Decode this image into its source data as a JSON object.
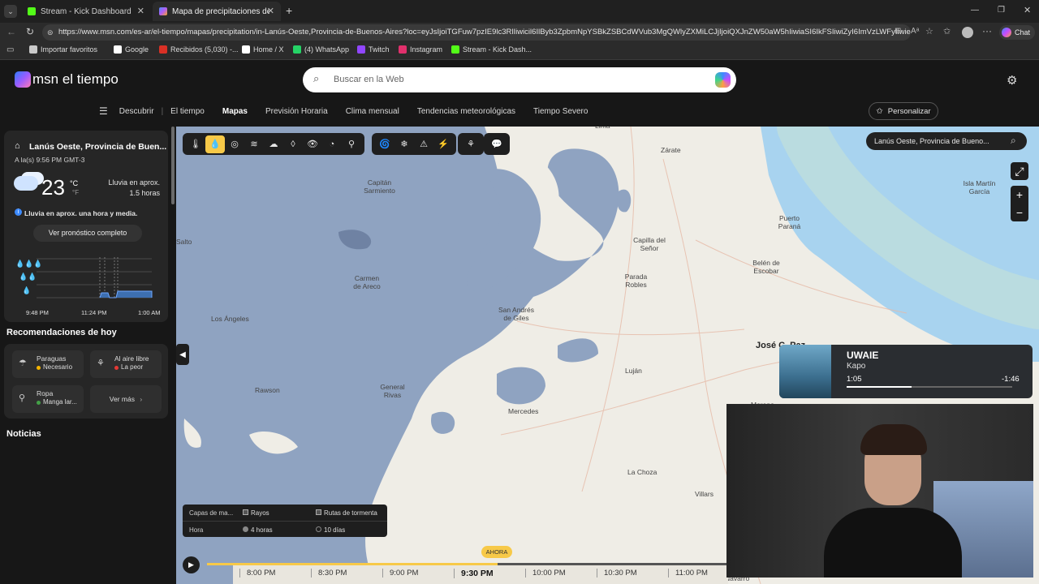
{
  "browser": {
    "tabs": [
      {
        "title": "Stream - Kick Dashboard",
        "active": false
      },
      {
        "title": "Mapa de precipitaciones de Lanús",
        "active": true
      }
    ],
    "url": "https://www.msn.com/es-ar/el-tiempo/mapas/precipitation/in-Lanús-Oeste,Provincia-de-Buenos-Aires?loc=eyJsIjoiTGFuw7pzIE9lc3RlIiwicil6IlByb3ZpbmNpYSBkZSBCdWVub3MgQWlyZXMiLCJjIjoiQXJnZW50aW5hIiwiaSI6IkFSIiwiZyI6ImVzLWFyIiwieC",
    "chat_label": "Chat",
    "bookmarks": [
      {
        "label": "Importar favoritos",
        "icon": "folder-icon",
        "color": "#c9c9c9"
      },
      {
        "label": "Google",
        "icon": "google-icon",
        "color": "#ffffff"
      },
      {
        "label": "Recibidos (5,030) -...",
        "icon": "gmail-icon",
        "color": "#d93025"
      },
      {
        "label": "Home / X",
        "icon": "x-icon",
        "color": "#ffffff"
      },
      {
        "label": "(4) WhatsApp",
        "icon": "whatsapp-icon",
        "color": "#25d366"
      },
      {
        "label": "Twitch",
        "icon": "twitch-icon",
        "color": "#9146ff"
      },
      {
        "label": "Instagram",
        "icon": "instagram-icon",
        "color": "#e1306c"
      },
      {
        "label": "Stream - Kick Dash...",
        "icon": "kick-icon",
        "color": "#53fc18"
      }
    ]
  },
  "msn": {
    "logo": "msn el tiempo",
    "search_placeholder": "Buscar en la Web",
    "nav": [
      "Descubrir",
      "El tiempo",
      "Mapas",
      "Previsión Horaria",
      "Clima mensual",
      "Tendencias meteorológicas",
      "Tiempo Severo"
    ],
    "nav_active": "Mapas",
    "personalize": "Personalizar"
  },
  "sidebar": {
    "location": "Lanús Oeste, Provincia de Buen...",
    "updated": "A la(s) 9:56 PM GMT-3",
    "temp": "23",
    "unit_c": "°C",
    "unit_f": "°F",
    "rain_summary": "Lluvia en aprox. 1.5 horas",
    "rain_line1": "Lluvia en aprox.",
    "rain_line2": "1.5 horas",
    "alert": "Lluvia en aprox. una hora y media.",
    "forecast_button": "Ver pronóstico completo",
    "chart_times": [
      "9:48 PM",
      "11:24 PM",
      "1:00 AM"
    ],
    "recommendations_title": "Recomendaciones de hoy",
    "recommendations": [
      {
        "title": "Paraguas",
        "value": "Necesario",
        "dot": "#f5b400",
        "icon": "umbrella-icon"
      },
      {
        "title": "Al aire libre",
        "value": "La peor",
        "dot": "#e53935",
        "icon": "outdoor-icon"
      },
      {
        "title": "Ropa",
        "value": "Manga lar...",
        "dot": "#43a047",
        "icon": "clothing-icon"
      }
    ],
    "see_more": "Ver más",
    "news_title": "Noticias"
  },
  "map": {
    "search_value": "Lanús Oeste, Provincia de Bueno...",
    "places": [
      {
        "name": "Lima"
      },
      {
        "name": "Zárate"
      },
      {
        "name": "Isla Martín García"
      },
      {
        "name": "Capitán Sarmiento"
      },
      {
        "name": "Puerto Paraná"
      },
      {
        "name": "Capilla del Señor"
      },
      {
        "name": "Salto"
      },
      {
        "name": "Carmen de Areco"
      },
      {
        "name": "Parada Robles"
      },
      {
        "name": "Belén de Escobar"
      },
      {
        "name": "San Andrés de Giles"
      },
      {
        "name": "Los Ángeles"
      },
      {
        "name": "José C. Paz"
      },
      {
        "name": "Luján"
      },
      {
        "name": "General Rivas"
      },
      {
        "name": "Rawson"
      },
      {
        "name": "Mercedes"
      },
      {
        "name": "Moreno"
      },
      {
        "name": "La Choza"
      },
      {
        "name": "Villars"
      },
      {
        "name": "Navarro"
      }
    ],
    "layers_label": "Capas de ma...",
    "layers": [
      "Rayos",
      "Rutas de tormenta"
    ],
    "hour_label": "Hora",
    "hour_options": [
      "4 horas",
      "10 días"
    ],
    "timeline": [
      "8:00 PM",
      "8:30 PM",
      "9:00 PM",
      "9:30 PM",
      "10:00 PM",
      "10:30 PM",
      "11:00 PM"
    ],
    "timeline_current": "9:30 PM",
    "now_label": "AHORA"
  },
  "player": {
    "title": "UWAIE",
    "artist": "Kapo",
    "elapsed": "1:05",
    "remaining": "-1:46",
    "progress": 0.39
  }
}
